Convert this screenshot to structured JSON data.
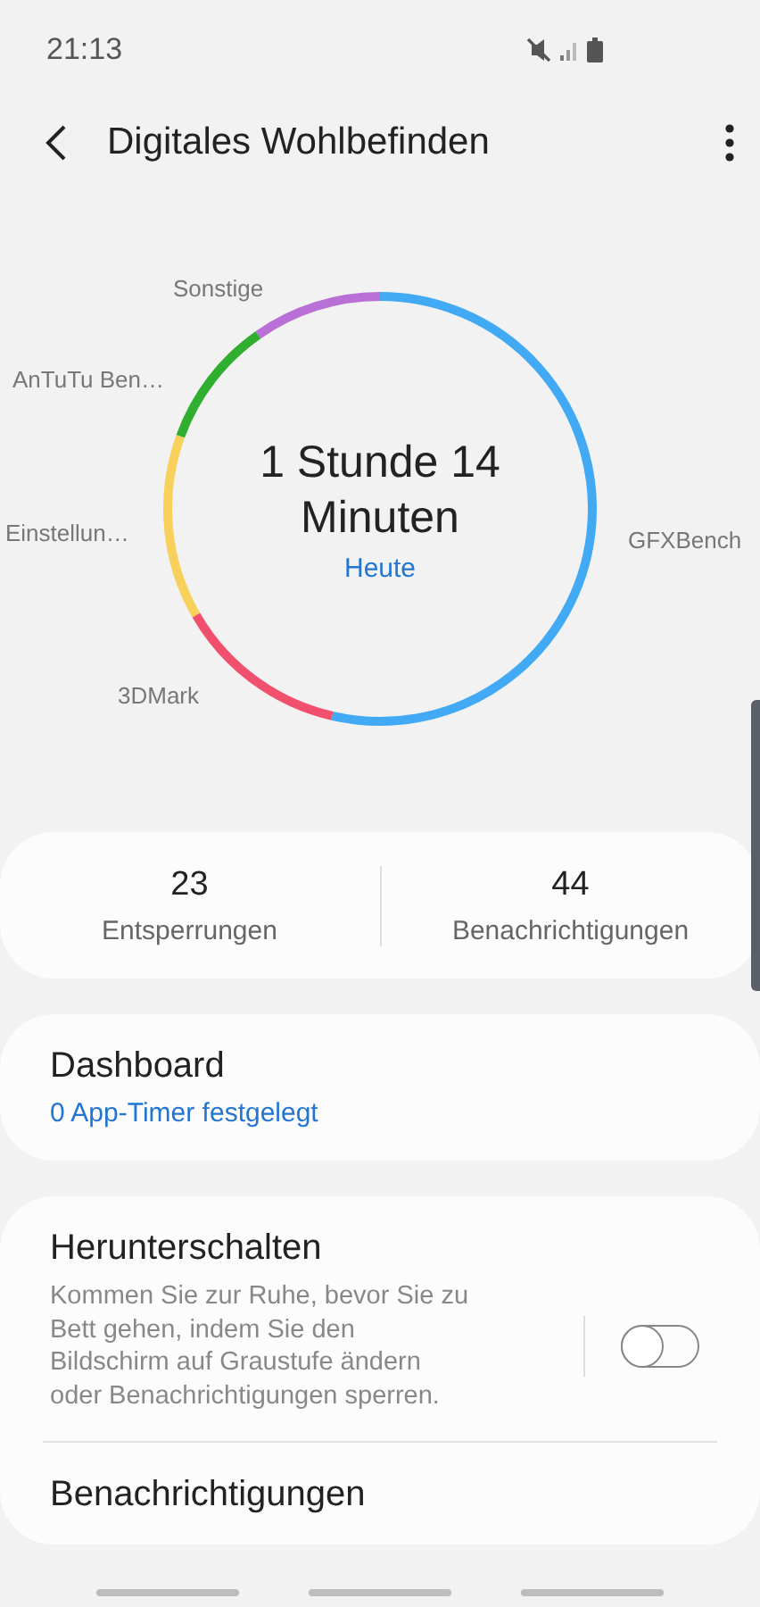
{
  "status_bar": {
    "time": "21:13"
  },
  "header": {
    "title": "Digitales Wohlbefinden"
  },
  "usage": {
    "total": "1 Stunde 14 Minuten",
    "period": "Heute",
    "segments": [
      {
        "label": "GFXBench",
        "color": "#42aaf5"
      },
      {
        "label": "3DMark",
        "color": "#f0506e"
      },
      {
        "label": "Einstellun…",
        "color": "#f7d15c"
      },
      {
        "label": "AnTuTu Ben…",
        "color": "#2fae2f"
      },
      {
        "label": "Sonstige",
        "color": "#b86fd6"
      }
    ]
  },
  "stats": [
    {
      "value": "23",
      "label": "Entsperrungen"
    },
    {
      "value": "44",
      "label": "Benachrichtigungen"
    }
  ],
  "dashboard": {
    "title": "Dashboard",
    "subtitle": "0 App-Timer festgelegt"
  },
  "wind_down": {
    "title": "Herunterschalten",
    "description": "Kommen Sie zur Ruhe, bevor Sie zu Bett gehen, indem Sie den Bildschirm auf Graustufe ändern oder Benachrichtigungen sperren.",
    "on": false
  },
  "notifications": {
    "title": "Benachrichtigungen"
  }
}
